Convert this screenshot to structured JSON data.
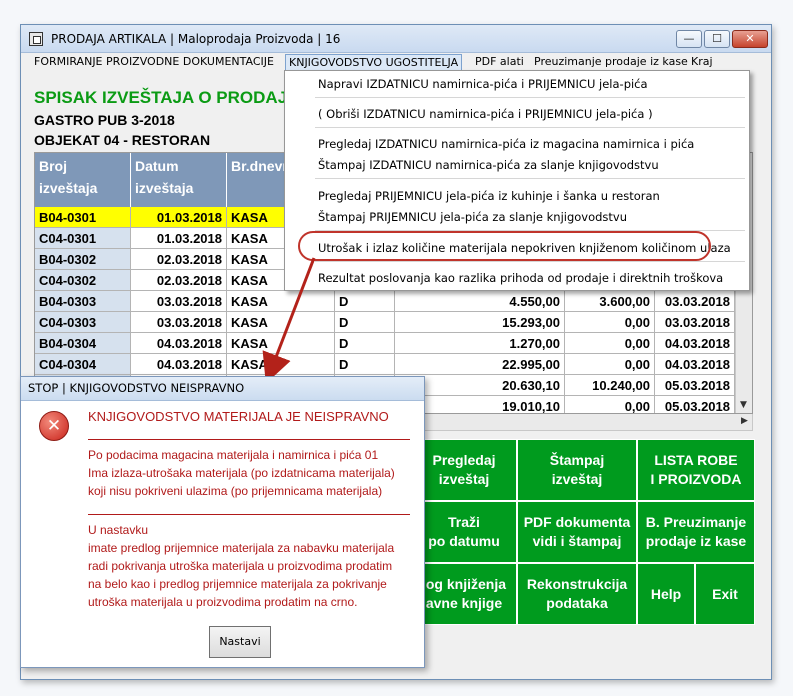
{
  "window": {
    "title": "PRODAJA ARTIKALA | Maloprodaja Proizvoda | 16",
    "min_glyph": "—",
    "max_glyph": "☐",
    "close_glyph": "✕"
  },
  "menubar": {
    "items": [
      "FORMIRANJE PROIZVODNE DOKUMENTACIJE",
      "KNJIGOVODSTVO UGOSTITELJA",
      "PDF alati",
      "Preuzimanje prodaje iz kase",
      "Kraj"
    ]
  },
  "header": {
    "title": "SPISAK IZVEŠTAJA O PRODAJI RO",
    "company": "GASTRO PUB 3-2018",
    "object": "OBJEKAT  04 - RESTORAN"
  },
  "table": {
    "headers": [
      "Broj\nizveštaja",
      "Datum\nizveštaja",
      "Br.dnevn"
    ],
    "rows": [
      {
        "broj": "B04-0301",
        "datum": "01.03.2018",
        "dnevnik": "KASA",
        "tip": "",
        "iznos1": "",
        "iznos2": "",
        "datum2": ""
      },
      {
        "broj": "C04-0301",
        "datum": "01.03.2018",
        "dnevnik": "KASA",
        "tip": "",
        "iznos1": "",
        "iznos2": "",
        "datum2": ""
      },
      {
        "broj": "B04-0302",
        "datum": "02.03.2018",
        "dnevnik": "KASA",
        "tip": "",
        "iznos1": "",
        "iznos2": "",
        "datum2": ""
      },
      {
        "broj": "C04-0302",
        "datum": "02.03.2018",
        "dnevnik": "KASA",
        "tip": "",
        "iznos1": "",
        "iznos2": "",
        "datum2": ""
      },
      {
        "broj": "B04-0303",
        "datum": "03.03.2018",
        "dnevnik": "KASA",
        "tip": "D",
        "iznos1": "4.550,00",
        "iznos2": "3.600,00",
        "datum2": "03.03.2018"
      },
      {
        "broj": "C04-0303",
        "datum": "03.03.2018",
        "dnevnik": "KASA",
        "tip": "D",
        "iznos1": "15.293,00",
        "iznos2": "0,00",
        "datum2": "03.03.2018"
      },
      {
        "broj": "B04-0304",
        "datum": "04.03.2018",
        "dnevnik": "KASA",
        "tip": "D",
        "iznos1": "1.270,00",
        "iznos2": "0,00",
        "datum2": "04.03.2018"
      },
      {
        "broj": "C04-0304",
        "datum": "04.03.2018",
        "dnevnik": "KASA",
        "tip": "D",
        "iznos1": "22.995,00",
        "iznos2": "0,00",
        "datum2": "04.03.2018"
      },
      {
        "broj": "",
        "datum": "",
        "dnevnik": "",
        "tip": "D",
        "iznos1": "20.630,10",
        "iznos2": "10.240,00",
        "datum2": "05.03.2018"
      },
      {
        "broj": "",
        "datum": "",
        "dnevnik": "",
        "tip": "",
        "iznos1": "19.010,10",
        "iznos2": "0,00",
        "datum2": "05.03.2018"
      }
    ]
  },
  "dropdown": {
    "items": [
      "Napravi IZDATNICU namirnica-pića i PRIJEMNICU jela-pića",
      "( Obriši IZDATNICU namirnica-pića i PRIJEMNICU jela-pića )",
      "Pregledaj IZDATNICU namirnica-pića iz magacina namirnica i pića",
      "Štampaj IZDATNICU namirnica-pića za slanje knjigovodstvu",
      "Pregledaj PRIJEMNICU jela-pića iz kuhinje i šanka u restoran",
      "Štampaj PRIJEMNICU jela-pića za slanje knjigovodstvu",
      "Utrošak i izlaz količine materijala nepokriven knjiženom količinom ulaza",
      "Rezultat poslovanja kao razlika prihoda od prodaje i direktnih troškova"
    ]
  },
  "buttons": {
    "pregledaj": "Pregledaj\nizveštaj",
    "stampaj": "Štampaj\nizveštaj",
    "lista": "LISTA ROBE\nI PROIZVODA",
    "trazi": "Traži\npo datumu",
    "pdf": "PDF dokumenta\nvidi i štampaj",
    "preuzimanje": "B. Preuzimanje\nprodaje iz kase",
    "pregled_knjizenja": "log knjiženja\navne knjige",
    "rekonstrukcija": "Rekonstrukcija\npodataka",
    "help": "Help",
    "exit": "Exit"
  },
  "dialog": {
    "title": "STOP | KNJIGOVODSTVO NEISPRAVNO",
    "heading": "KNJIGOVODSTVO MATERIJALA JE NEISPRAVNO",
    "p1": [
      "Po podacima magacina materijala i namirnica i pića 01",
      "Ima izlaza-utrošaka materijala (po izdatnicama materijala)",
      "koji nisu pokriveni ulazima (po prijemnicama materijala)"
    ],
    "p2": [
      "U nastavku",
      "imate predlog prijemnice materijala za nabavku materijala",
      "radi pokrivanja utroška materijala u proizvodima prodatim",
      "na belo kao i predlog prijemnice materijala za pokrivanje",
      "utroška materijala u proizvodima prodatim na crno."
    ],
    "ok_label": "Nastavi"
  },
  "colors": {
    "accent_green": "#009b1e",
    "header_blue": "#7f98b8",
    "selected_row": "#ffff00",
    "error_red": "#b11a1a"
  }
}
